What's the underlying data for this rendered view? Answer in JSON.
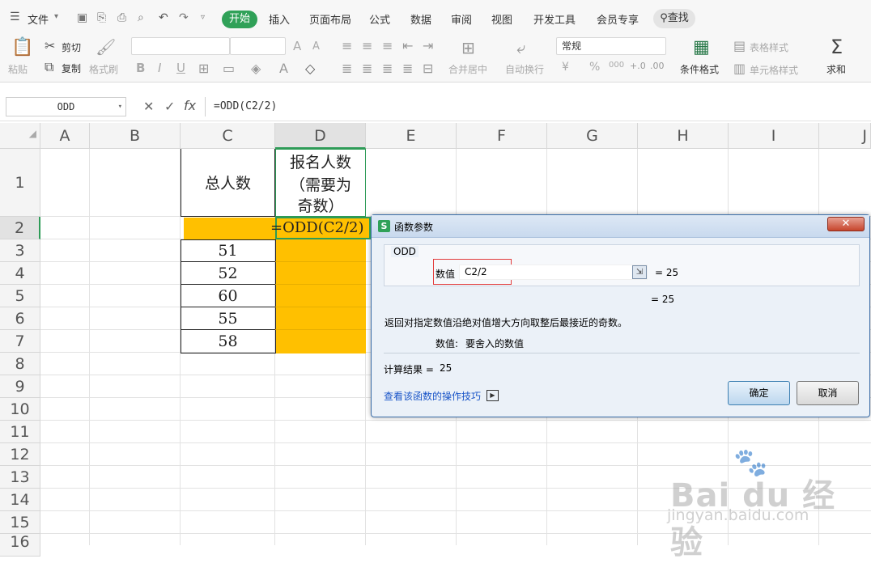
{
  "menu": {
    "file": "文件",
    "tabs": [
      "开始",
      "插入",
      "页面布局",
      "公式",
      "数据",
      "审阅",
      "视图",
      "开发工具",
      "会员专享"
    ],
    "active_tab": "开始",
    "search": "查找"
  },
  "toolbar": {
    "paste": "粘贴",
    "cut": "剪切",
    "copy": "复制",
    "format_painter": "格式刷",
    "number_format": "常规",
    "merge_center": "合并居中",
    "auto_wrap": "自动换行",
    "conditional_format": "条件格式",
    "table_style": "表格样式",
    "cell_style": "单元格样式",
    "sum": "求和",
    "font_size_up": "A",
    "font_size_down": "A",
    "bold": "B",
    "italic": "I",
    "underline": "U",
    "currency": "¥",
    "percent": "%",
    "thousands": "000"
  },
  "formula_bar": {
    "name_box": "ODD",
    "fx": "fx",
    "formula": "=ODD(C2/2)"
  },
  "grid": {
    "columns": [
      "A",
      "B",
      "C",
      "D",
      "E",
      "F",
      "G",
      "H",
      "I",
      "J"
    ],
    "rows": [
      "1",
      "2",
      "3",
      "4",
      "5",
      "6",
      "7",
      "8",
      "9",
      "10",
      "11",
      "12",
      "13",
      "14",
      "15",
      "16"
    ],
    "header_c1": "总人数",
    "header_d1_lines": [
      "报名人数",
      "（需要为",
      "奇数）"
    ],
    "editing_formula": "=ODD(C2/2)",
    "c_values": [
      "51",
      "52",
      "60",
      "55",
      "58"
    ],
    "highlight_color": "#ffc000"
  },
  "dialog": {
    "title": "函数参数",
    "function_name": "ODD",
    "param_label": "数值",
    "param_value": "C2/2",
    "param_result": "= 25",
    "formula_result_preview": "= 25",
    "description": "返回对指定数值沿绝对值增大方向取整后最接近的奇数。",
    "param_desc_label": "数值:",
    "param_desc": "要舍入的数值",
    "result_label": "计算结果 =",
    "result_value": "25",
    "help_link": "查看该函数的操作技巧",
    "ok": "确定",
    "cancel": "取消"
  },
  "watermark": {
    "brand": "Bai du 经验",
    "url": "jingyan.baidu.com"
  }
}
